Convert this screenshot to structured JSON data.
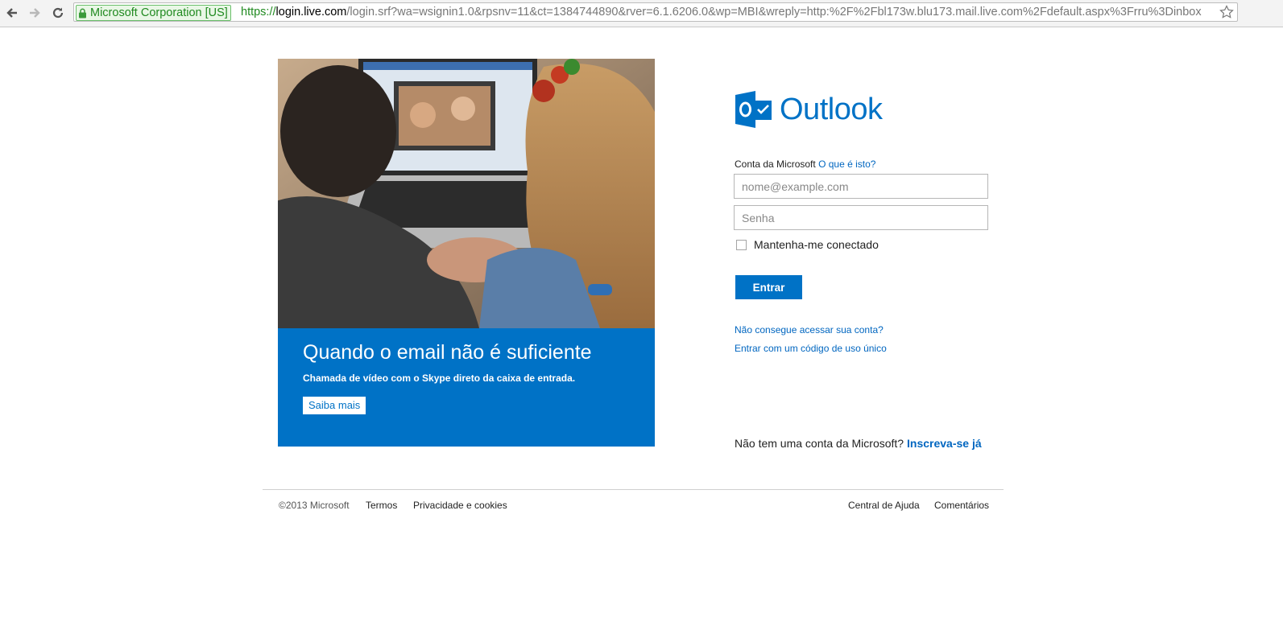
{
  "browser": {
    "ev_label": "Microsoft Corporation [US]",
    "url_scheme": "https://",
    "url_host": "login.live.com",
    "url_path": "/login.srf?wa=wsignin1.0&rpsnv=11&ct=1384744890&rver=6.1.6206.0&wp=MBI&wreply=http:%2F%2Fbl173w.blu173.mail.live.com%2Fdefault.aspx%3Frru%3Dinbox"
  },
  "hero": {
    "title": "Quando o email não é suficiente",
    "subtitle": "Chamada de vídeo com o Skype direto da caixa de entrada.",
    "button_label": "Saiba mais"
  },
  "login": {
    "logo_text": "Outlook",
    "account_label": "Conta da Microsoft",
    "what_is_this": "O que é isto?",
    "email_placeholder": "nome@example.com",
    "password_placeholder": "Senha",
    "keep_signed_in": "Mantenha-me conectado",
    "signin_label": "Entrar",
    "cant_access": "Não consegue acessar sua conta?",
    "single_use_code": "Entrar com um código de uso único",
    "no_account": "Não tem uma conta da Microsoft?",
    "signup_link": "Inscreva-se já"
  },
  "footer": {
    "copyright": "©2013 Microsoft",
    "terms": "Termos",
    "privacy": "Privacidade e cookies",
    "help": "Central de Ajuda",
    "feedback": "Comentários"
  },
  "colors": {
    "brand_blue": "#0072c6",
    "link_blue": "#0066c0"
  }
}
